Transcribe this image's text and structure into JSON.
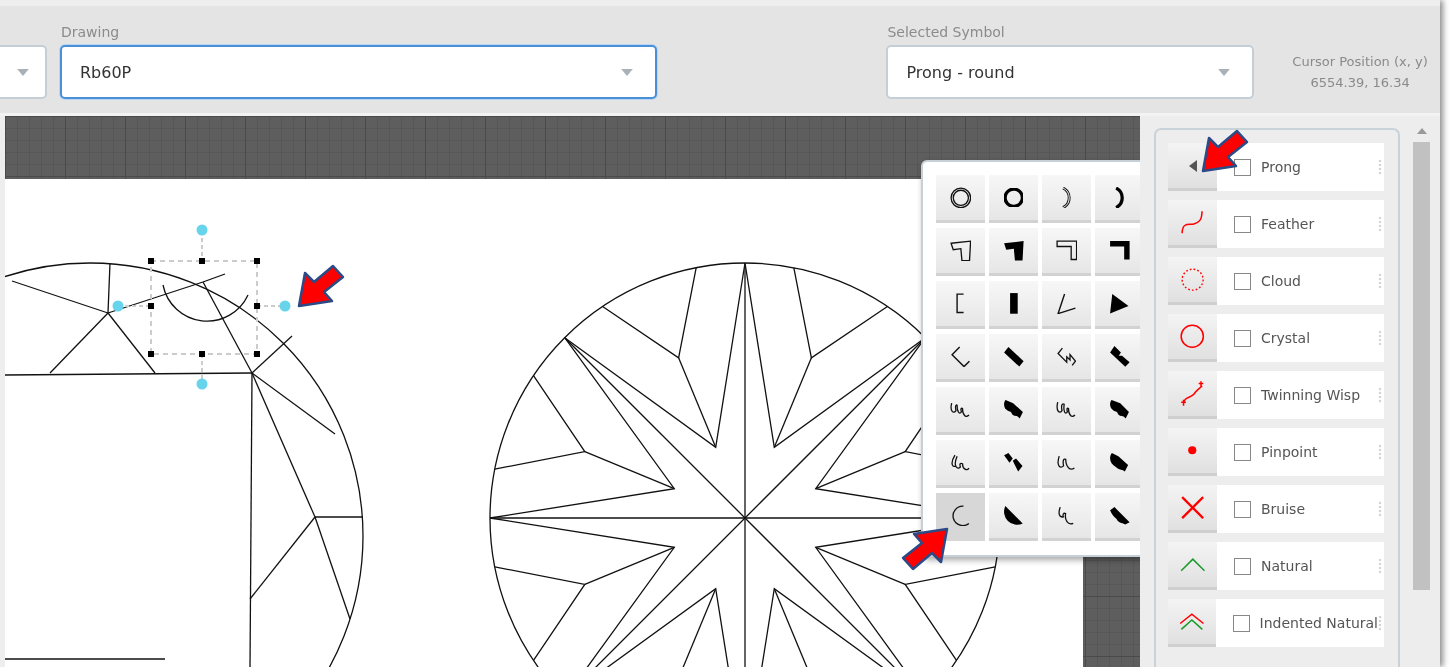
{
  "toolbar": {
    "drawing": {
      "label": "Drawing",
      "value": "Rb60P",
      "focused": true
    },
    "selected_symbol": {
      "label": "Selected Symbol",
      "value": "Prong - round"
    },
    "cursor_position": {
      "label": "Cursor Position (x, y)",
      "value": "6554.39, 16.34"
    }
  },
  "palette": {
    "tiles": [
      {
        "selected": false
      },
      {
        "selected": false
      },
      {
        "selected": false
      },
      {
        "selected": false
      },
      {
        "selected": false
      },
      {
        "selected": false
      },
      {
        "selected": false
      },
      {
        "selected": false
      },
      {
        "selected": false
      },
      {
        "selected": false
      },
      {
        "selected": false
      },
      {
        "selected": false
      },
      {
        "selected": false
      },
      {
        "selected": false
      },
      {
        "selected": false
      },
      {
        "selected": false
      },
      {
        "selected": false
      },
      {
        "selected": false
      },
      {
        "selected": false
      },
      {
        "selected": false
      },
      {
        "selected": false
      },
      {
        "selected": false
      },
      {
        "selected": false
      },
      {
        "selected": false
      },
      {
        "selected": true
      },
      {
        "selected": false
      },
      {
        "selected": false
      },
      {
        "selected": false
      }
    ]
  },
  "symbols": [
    {
      "kind": "toggle",
      "label": "Prong",
      "checked": false,
      "expanded": true
    },
    {
      "kind": "symbol",
      "label": "Feather",
      "checked": false
    },
    {
      "kind": "symbol",
      "label": "Cloud",
      "checked": false
    },
    {
      "kind": "symbol",
      "label": "Crystal",
      "checked": false
    },
    {
      "kind": "symbol",
      "label": "Twinning Wisp",
      "checked": false
    },
    {
      "kind": "symbol",
      "label": "Pinpoint",
      "checked": false
    },
    {
      "kind": "symbol",
      "label": "Bruise",
      "checked": false
    },
    {
      "kind": "symbol",
      "label": "Natural",
      "checked": false
    },
    {
      "kind": "symbol",
      "label": "Indented Natural",
      "checked": false
    }
  ]
}
